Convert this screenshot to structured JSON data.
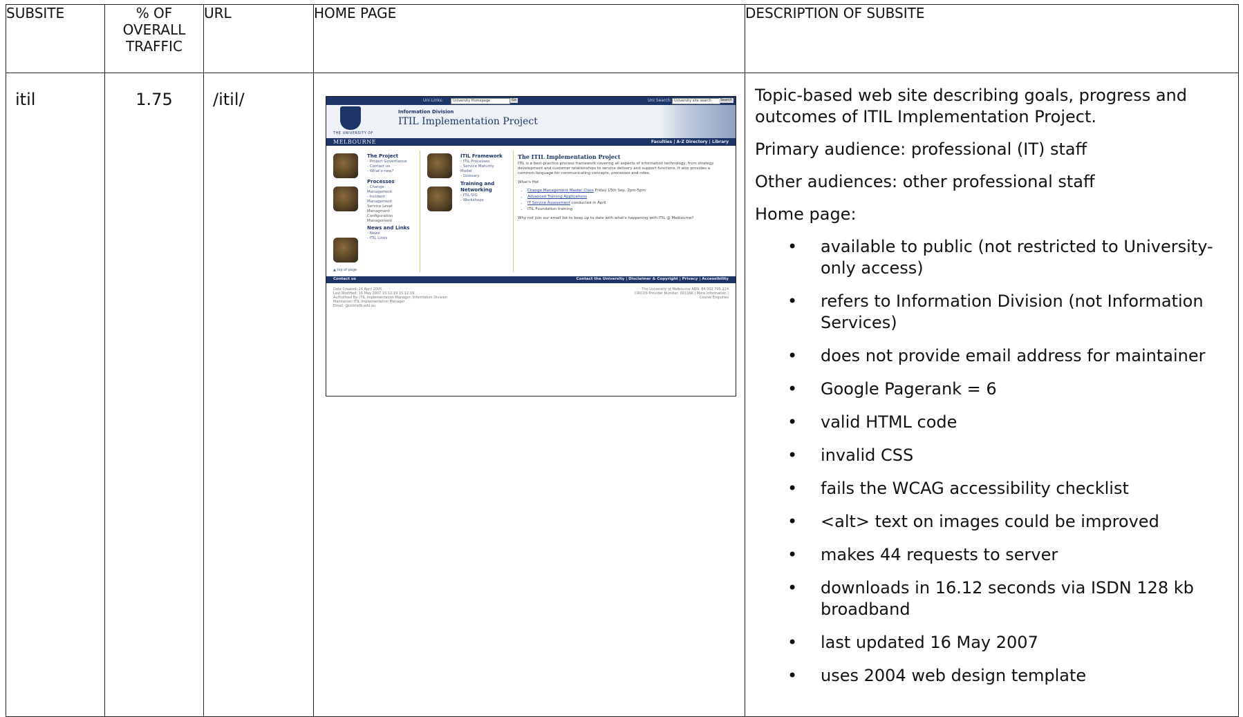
{
  "headers": {
    "subsite": "SUBSITE",
    "traffic_line1": "% OF",
    "traffic_line2": "OVERALL",
    "traffic_line3": "TRAFFIC",
    "url": "URL",
    "home_page": "HOME PAGE",
    "description": "DESCRIPTION OF SUBSITE"
  },
  "row": {
    "subsite": "itil",
    "traffic": "1.75",
    "url": "/itil/",
    "description": {
      "intro": "Topic-based web site describing goals, progress and outcomes of ITIL Implementation Project.",
      "primary_audience": "Primary audience: professional (IT) staff",
      "other_audiences": "Other audiences: other professional staff",
      "home_page_label": "Home page:",
      "bullets": [
        "available to public (not restricted to University-only access)",
        "refers to Information Division (not Information Services)",
        "does not provide email address for maintainer",
        "Google Pagerank = 6",
        "valid HTML code",
        "invalid CSS",
        "fails the WCAG accessibility checklist",
        "<alt> text on images could be improved",
        "makes 44 requests to server",
        "downloads in 16.12 seconds via ISDN 128 kb broadband",
        "last updated 16 May 2007",
        "uses 2004 web design template"
      ]
    }
  },
  "thumbnail": {
    "uni_links_label": "Uni Links:",
    "uni_links_value": "University Homepage",
    "go": "Go",
    "uni_search_label": "Uni Search:",
    "uni_search_value": "University site search",
    "search_btn": "Search",
    "crest_label": "THE UNIVERSITY OF",
    "university": "MELBOURNE",
    "division": "Information Division",
    "title": "ITIL Implementation Project",
    "nav_links": "Faculties | A-Z Directory | Library",
    "col1": {
      "s1": "The Project",
      "s1_links": [
        "- Project Governance",
        "- Contact us",
        "- What's new?"
      ],
      "s2": "Processes",
      "s2_links": [
        "- Change",
        "  Management",
        "- Incident",
        "  Management"
      ],
      "s2_plain": [
        "Service Level",
        "Managment",
        "Configuration",
        "Management"
      ],
      "s3": "News and Links",
      "s3_links": [
        "- News",
        "- ITIL Links"
      ]
    },
    "col2": {
      "s1": "ITIL Framework",
      "s1_links": [
        "- ITIL Processes",
        "- Service Maturity",
        "  Model",
        "- Glossary"
      ],
      "s2": "Training and Networking",
      "s2_links": [
        "- ITIL-SIG",
        "- Workshops"
      ]
    },
    "main_heading": "The ITIL Implementation Project",
    "main_text": "ITIL is a best-practice process framework covering all aspects of information technology, from strategy development and customer relationships to service delivery and support functions. It also provides a common language for communicating concepts, processes and roles.",
    "whats_hot": "What's Hot",
    "hot_items": [
      {
        "link": "Change Management Master Class",
        "rest": " Friday 15th Sep. 2pm-5pm"
      },
      {
        "link": "Advanced Training Applications",
        "rest": ""
      },
      {
        "link": "IT Service Assessment",
        "rest": " conducted in April"
      },
      {
        "link": "",
        "rest": "ITIL Foundation training"
      }
    ],
    "join_text": "Why not join our email list to keep up to date with what's happening with ITIL @ Melbourne?",
    "top_link": "▲ top of page",
    "footer_left": "Contact us",
    "footer_right": "Contact the University | Disclaimer & Copyright | Privacy | Accessibility",
    "meta": [
      "Date Created: 14 April 2005",
      "Last Modified: 16 May 2007 15:12:19 15:12:19",
      "Authorised By: ITIL Implementation Manager, Information Division",
      "Maintainer: ITIL Implementation Manager",
      "Email: @unimelb.edu.au"
    ],
    "meta_right": [
      "The University of Melbourne ABN: 84 002 705 224",
      "CRICOS Provider Number: 00116K | More information |",
      "Course Enquiries"
    ]
  }
}
